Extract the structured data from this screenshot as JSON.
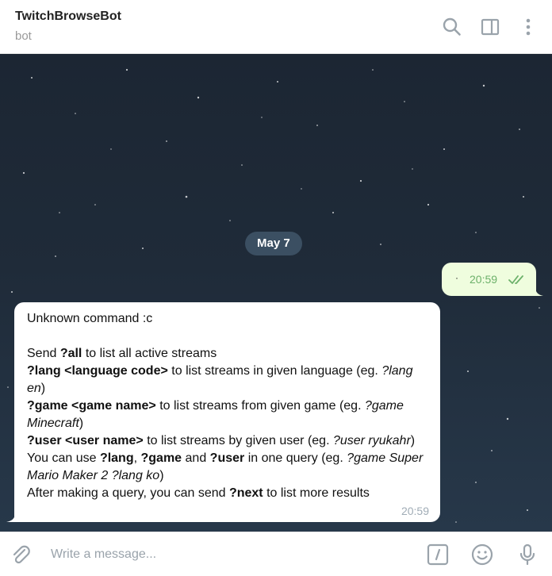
{
  "header": {
    "title": "TwitchBrowseBot",
    "status": "bot",
    "icons": [
      "search-icon",
      "sidebar-toggle-icon",
      "more-vertical-icon"
    ]
  },
  "chat": {
    "date_label": "May 7",
    "outgoing": {
      "text": "·",
      "time": "20:59",
      "status_icon": "double-check-icon"
    },
    "incoming": {
      "time": "20:59",
      "lines": [
        [
          "Unknown command :c"
        ],
        [],
        [
          "Send ",
          "?all",
          " to list all active streams"
        ],
        [
          "?lang <language code>",
          " to list streams in given language (eg. ",
          "?lang"
        ],
        [
          "en",
          ")"
        ],
        [
          "?game <game name>",
          " to list streams from given game (eg. ",
          "?game"
        ],
        [
          "Minecraft",
          ")"
        ],
        [
          "?user <user name>",
          " to list streams by given user (eg. ",
          "?user ryukahr",
          ")"
        ],
        [
          "You can use ",
          "?lang",
          ", ",
          "?game",
          " and ",
          "?user",
          " in one query (eg. ",
          "?game Super"
        ],
        [
          "Mario Maker 2 ?lang ko",
          ")"
        ],
        [
          "After making a query, you can send ",
          "?next",
          " to list more results"
        ]
      ]
    }
  },
  "composer": {
    "placeholder": "Write a message...",
    "icons": [
      "attach-icon",
      "bot-command-icon",
      "emoji-icon",
      "microphone-icon"
    ]
  },
  "colors": {
    "outgoing_bubble": "#effdde",
    "outgoing_time": "#6cb16a",
    "incoming_bubble": "#ffffff",
    "date_pill": "#405468",
    "chat_background": "#1f2b39"
  }
}
